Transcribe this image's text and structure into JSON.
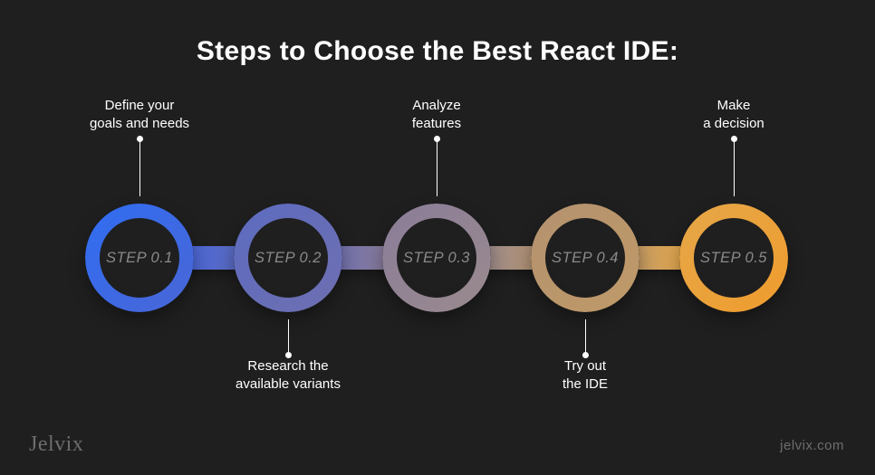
{
  "title": "Steps to Choose the Best React IDE:",
  "steps": [
    {
      "label": "STEP 0.1",
      "caption": "Define your\ngoals and needs",
      "position": "top"
    },
    {
      "label": "STEP 0.2",
      "caption": "Research the\navailable variants",
      "position": "bottom"
    },
    {
      "label": "STEP 0.3",
      "caption": "Analyze\nfeatures",
      "position": "top"
    },
    {
      "label": "STEP 0.4",
      "caption": "Try out\nthe IDE",
      "position": "bottom"
    },
    {
      "label": "STEP 0.5",
      "caption": "Make\na decision",
      "position": "top"
    }
  ],
  "brand": {
    "name": "Jelvix",
    "url": "jelvix.com"
  },
  "colors": {
    "bg": "#1f1f1f",
    "gradient_start": "#2f6df2",
    "gradient_end": "#ef9c2d"
  }
}
